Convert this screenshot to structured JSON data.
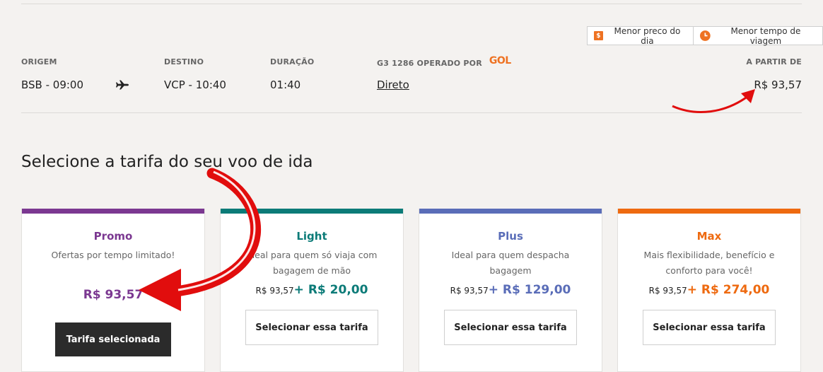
{
  "sort": {
    "cheapest_label": "Menor preco do dia",
    "fastest_label": "Menor tempo de viagem"
  },
  "flight": {
    "origin_label": "ORIGEM",
    "origin_value": "BSB - 09:00",
    "destination_label": "DESTINO",
    "destination_value": "VCP - 10:40",
    "duration_label": "DURAÇÃO",
    "duration_value": "01:40",
    "operator_label": "G3 1286 OPERADO POR",
    "airline_logo": "GOL",
    "stops_value": "Direto",
    "price_label": "A PARTIR DE",
    "price_value": "R$ 93,57"
  },
  "section_title": "Selecione a tarifa do seu voo de ida",
  "fares": [
    {
      "name": "Promo",
      "description": "Ofertas por tempo limitado!",
      "price": "R$ 93,57",
      "button": "Tarifa selecionada",
      "color": "#7b3891"
    },
    {
      "name": "Light",
      "description": "Ideal para quem só viaja com\nbagagem de mão",
      "base_price": "R$ 93,57",
      "extra_price": "+ R$ 20,00",
      "button": "Selecionar essa tarifa",
      "color": "#0c7b78"
    },
    {
      "name": "Plus",
      "description": "Ideal para quem despacha\nbagagem",
      "base_price": "R$ 93,57",
      "extra_price": "+ R$ 129,00",
      "button": "Selecionar essa tarifa",
      "color": "#5a6db8"
    },
    {
      "name": "Max",
      "description": "Mais flexibilidade, benefício e\nconforto para você!",
      "base_price": "R$ 93,57",
      "extra_price": "+ R$ 274,00",
      "button": "Selecionar essa tarifa",
      "color": "#ee6a10"
    }
  ],
  "icons": {
    "dollar": "dollar-icon",
    "clock": "clock-icon",
    "plane": "plane-icon"
  }
}
